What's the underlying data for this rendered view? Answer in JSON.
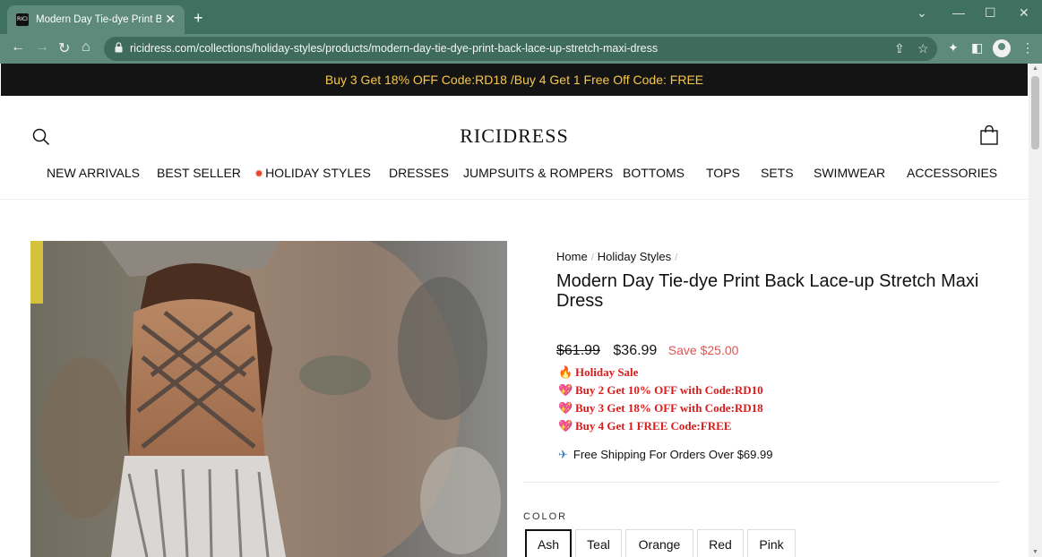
{
  "browser": {
    "tab_title": "Modern Day Tie-dye Print Back Lace-up Stretch Maxi Dress",
    "favicon_text": "RICI",
    "url": "ricidress.com/collections/holiday-styles/products/modern-day-tie-dye-print-back-lace-up-stretch-maxi-dress",
    "theme_color": "#3f7060"
  },
  "announcement": {
    "text": "Buy 3 Get 18% OFF Code:RD18 /Buy 4 Get 1 Free Off Code:  FREE",
    "text_color": "#f6c84a"
  },
  "header": {
    "logo": "RICIDRESS",
    "nav": [
      {
        "label": "NEW ARRIVALS"
      },
      {
        "label": "BEST SELLER"
      },
      {
        "label": "HOLIDAY STYLES",
        "icon": "star-icon"
      },
      {
        "label": "DRESSES"
      },
      {
        "label": "JUMPSUITS & ROMPERS"
      },
      {
        "label": "BOTTOMS"
      },
      {
        "label": "TOPS"
      },
      {
        "label": "SETS"
      },
      {
        "label": "SWIMWEAR"
      },
      {
        "label": "ACCESSORIES"
      }
    ]
  },
  "product": {
    "breadcrumb": [
      "Home",
      "Holiday Styles"
    ],
    "title": "Modern Day Tie-dye Print Back Lace-up Stretch Maxi Dress",
    "old_price": "$61.99",
    "price": "$36.99",
    "save": "Save $25.00",
    "promos": [
      {
        "icon": "fire-icon",
        "text": "Holiday Sale"
      },
      {
        "icon": "heart-icon",
        "text": "Buy 2 Get 10% OFF with Code:RD10"
      },
      {
        "icon": "heart-icon",
        "text": "Buy 3 Get 18% OFF with Code:RD18"
      },
      {
        "icon": "heart-icon",
        "text": "Buy 4 Get 1 FREE Code:FREE"
      }
    ],
    "shipping": "Free Shipping For Orders Over $69.99",
    "color_label": "COLOR",
    "colors": [
      "Ash",
      "Teal",
      "Orange",
      "Red",
      "Pink"
    ],
    "selected_color": "Ash",
    "accent_red": "#d91d1d",
    "save_color": "#e05451"
  }
}
